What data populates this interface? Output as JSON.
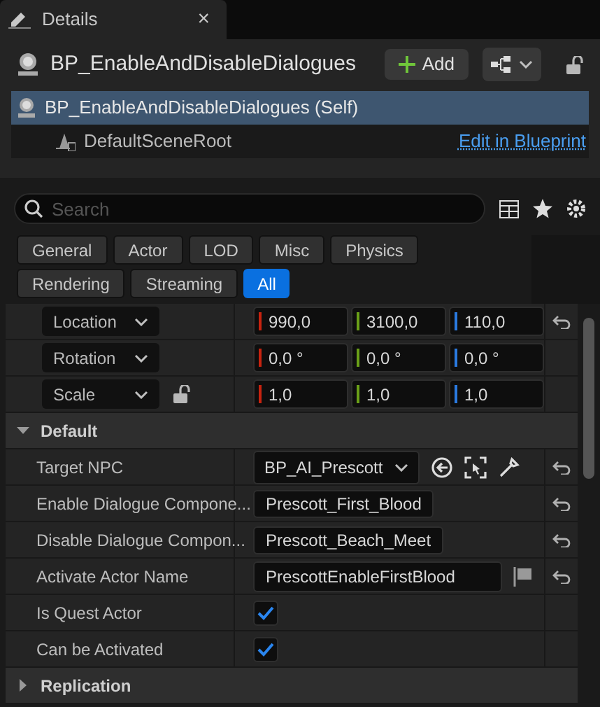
{
  "tab": {
    "title": "Details",
    "close": "×"
  },
  "header": {
    "actor": "BP_EnableAndDisableDialogues",
    "add_button": "Add"
  },
  "components": [
    {
      "label": "BP_EnableAndDisableDialogues (Self)",
      "selected": true,
      "kind": "actor"
    },
    {
      "label": "DefaultSceneRoot",
      "selected": false,
      "kind": "scene",
      "link": "Edit in Blueprint"
    }
  ],
  "search": {
    "placeholder": "Search"
  },
  "filters": [
    {
      "label": "General",
      "selected": false
    },
    {
      "label": "Actor",
      "selected": false
    },
    {
      "label": "LOD",
      "selected": false
    },
    {
      "label": "Misc",
      "selected": false
    },
    {
      "label": "Physics",
      "selected": false
    },
    {
      "label": "Rendering",
      "selected": false
    },
    {
      "label": "Streaming",
      "selected": false
    },
    {
      "label": "All",
      "selected": true
    }
  ],
  "transform": [
    {
      "label": "Location",
      "lock": false,
      "resettable": true,
      "values": [
        {
          "text": "990,0",
          "color": "#c8230f"
        },
        {
          "text": "3100,0",
          "color": "#6aa018"
        },
        {
          "text": "110,0",
          "color": "#2a7ae0"
        }
      ]
    },
    {
      "label": "Rotation",
      "lock": false,
      "resettable": false,
      "values": [
        {
          "text": "0,0 °",
          "color": "#c8230f"
        },
        {
          "text": "0,0 °",
          "color": "#6aa018"
        },
        {
          "text": "0,0 °",
          "color": "#2a7ae0"
        }
      ]
    },
    {
      "label": "Scale",
      "lock": true,
      "resettable": false,
      "values": [
        {
          "text": "1,0",
          "color": "#c8230f"
        },
        {
          "text": "1,0",
          "color": "#6aa018"
        },
        {
          "text": "1,0",
          "color": "#2a7ae0"
        }
      ]
    }
  ],
  "sections": [
    {
      "title": "Default",
      "expanded": true,
      "properties": [
        {
          "label": "Target NPC",
          "kind": "object",
          "value": "BP_AI_Prescott",
          "resettable": true
        },
        {
          "label": "Enable Dialogue Compone...",
          "kind": "text",
          "value": "Prescott_First_Blood",
          "resettable": true
        },
        {
          "label": "Disable Dialogue Compon...",
          "kind": "text",
          "value": "Prescott_Beach_Meet",
          "resettable": true
        },
        {
          "label": "Activate Actor Name",
          "kind": "name",
          "value": "PrescottEnableFirstBlood",
          "resettable": true
        },
        {
          "label": "Is Quest Actor",
          "kind": "checkbox",
          "checked": true,
          "resettable": false
        },
        {
          "label": "Can be Activated",
          "kind": "checkbox",
          "checked": true,
          "resettable": false
        }
      ]
    },
    {
      "title": "Replication",
      "expanded": false
    }
  ]
}
